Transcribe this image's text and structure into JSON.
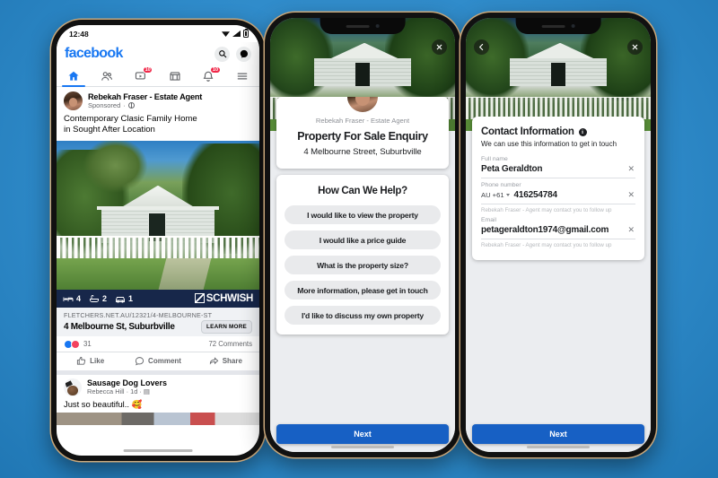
{
  "background_color": "#2f8bca",
  "phone1": {
    "status": {
      "time": "12:48",
      "wifi": "wifi-icon",
      "signal": "signal-icon",
      "battery": "battery-icon"
    },
    "app_header": {
      "logo": "facebook",
      "search_icon": "search-icon",
      "messenger_icon": "messenger-icon"
    },
    "nav": [
      {
        "name": "home",
        "icon": "home-icon",
        "badge": "",
        "active": true
      },
      {
        "name": "friends",
        "icon": "friends-icon",
        "badge": "",
        "active": false
      },
      {
        "name": "watch",
        "icon": "watch-icon",
        "badge": "10",
        "active": false
      },
      {
        "name": "marketplace",
        "icon": "marketplace-icon",
        "badge": "",
        "active": false
      },
      {
        "name": "notifications",
        "icon": "notifications-icon",
        "badge": "10",
        "active": false
      },
      {
        "name": "menu",
        "icon": "hamburger-icon",
        "badge": "",
        "active": false
      }
    ],
    "post": {
      "page_name": "Rebekah Fraser - Estate Agent",
      "sponsored_label": "Sponsored",
      "privacy_icon": "globe-icon",
      "body_line1": "Contemporary Clasic Family Home",
      "body_line2": "in Sought After Location",
      "specs": [
        {
          "icon": "bed-icon",
          "value": "4"
        },
        {
          "icon": "bath-icon",
          "value": "2"
        },
        {
          "icon": "car-icon",
          "value": "1"
        }
      ],
      "brand": "SCHWISH",
      "link_url": "FLETCHERS.NET.AU/12321/4-MELBOURNE-ST",
      "link_title": "4 Melbourne St, Suburbville",
      "cta_label": "LEARN MORE",
      "reaction_count": "31",
      "comments_count": "72 Comments",
      "actions": [
        {
          "label": "Like",
          "icon": "thumbs-up-icon"
        },
        {
          "label": "Comment",
          "icon": "comment-icon"
        },
        {
          "label": "Share",
          "icon": "share-icon"
        }
      ]
    },
    "post2": {
      "page_name": "Sausage Dog Lovers",
      "author": "Rebecca Hill",
      "time": "1d",
      "privacy_icon": "group-icon",
      "text": "Just so beautiful.. 🥰"
    }
  },
  "phone2": {
    "close_icon": "close-icon",
    "agent_name": "Rebekah Fraser - Estate Agent",
    "form_title": "Property For Sale Enquiry",
    "form_subtitle": "4 Melbourne Street, Suburbville",
    "question_title": "How Can We Help?",
    "options": [
      "I would like to view the property",
      "I would like a price guide",
      "What is the property size?",
      "More information, please get in touch",
      "I'd like to discuss my own property"
    ],
    "next_label": "Next"
  },
  "phone3": {
    "back_icon": "back-arrow-icon",
    "close_icon": "close-icon",
    "section_title": "Contact Information",
    "info_icon": "info-icon",
    "section_subtitle": "We can use this information to get in touch",
    "fields": [
      {
        "label": "Full name",
        "value": "Peta Geraldton",
        "clear_icon": "clear-icon",
        "help": ""
      },
      {
        "label": "Phone number",
        "country_code": "AU +61",
        "value": "416254784",
        "clear_icon": "clear-icon",
        "help": "Rebekah Fraser - Agent may contact you to follow up"
      },
      {
        "label": "Email",
        "value": "petageraldton1974@gmail.com",
        "clear_icon": "clear-icon",
        "help": "Rebekah Fraser - Agent may contact you to follow up"
      }
    ],
    "next_label": "Next"
  }
}
